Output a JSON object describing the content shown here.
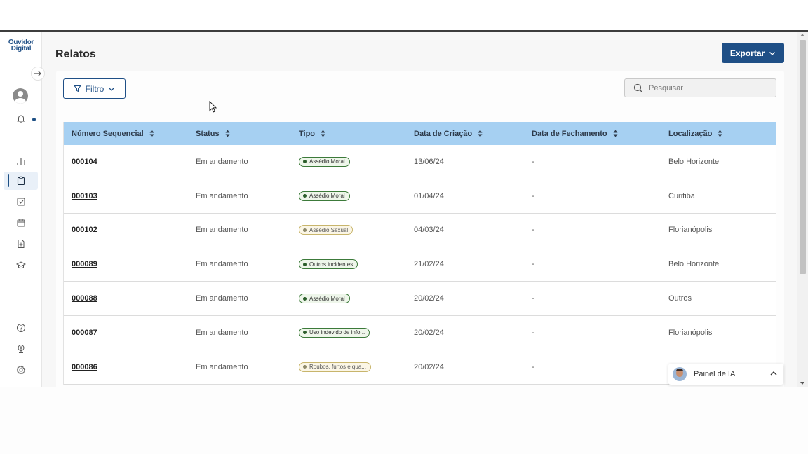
{
  "app": {
    "logo_line1": "Ouvidor",
    "logo_line2": "Digital",
    "page_title": "Relatos",
    "colors": {
      "brand": "#1f4f86",
      "table_header": "#a6d0f2",
      "tag_green": "#3c7a3a",
      "tag_yellow": "#c8b56c"
    }
  },
  "sidebar": {
    "items": [
      {
        "icon": "chart-icon"
      },
      {
        "icon": "clipboard-icon",
        "active": true
      },
      {
        "icon": "checkbox-icon"
      },
      {
        "icon": "calendar-icon"
      },
      {
        "icon": "file-add-icon"
      },
      {
        "icon": "graduation-cap-icon"
      }
    ],
    "bottom_items": [
      {
        "icon": "help-icon"
      },
      {
        "icon": "webcam-icon"
      },
      {
        "icon": "gear-icon"
      }
    ]
  },
  "toolbar": {
    "export_label": "Exportar",
    "filter_label": "Filtro",
    "search_placeholder": "Pesquisar"
  },
  "table": {
    "headers": [
      "Número Sequencial",
      "Status",
      "Tipo",
      "Data de Criação",
      "Data de Fechamento",
      "Localização"
    ],
    "rows": [
      {
        "seq": "000104",
        "status": "Em andamento",
        "tipo": "Assédio Moral",
        "tipo_color": "green",
        "criacao": "13/06/24",
        "fechamento": "-",
        "local": "Belo Horizonte"
      },
      {
        "seq": "000103",
        "status": "Em andamento",
        "tipo": "Assédio Moral",
        "tipo_color": "green",
        "criacao": "01/04/24",
        "fechamento": "-",
        "local": "Curitiba"
      },
      {
        "seq": "000102",
        "status": "Em andamento",
        "tipo": "Assédio Sexual",
        "tipo_color": "yellow",
        "criacao": "04/03/24",
        "fechamento": "-",
        "local": "Florianópolis"
      },
      {
        "seq": "000089",
        "status": "Em andamento",
        "tipo": "Outros incidentes",
        "tipo_color": "green",
        "criacao": "21/02/24",
        "fechamento": "-",
        "local": "Belo Horizonte"
      },
      {
        "seq": "000088",
        "status": "Em andamento",
        "tipo": "Assédio Moral",
        "tipo_color": "green",
        "criacao": "20/02/24",
        "fechamento": "-",
        "local": "Outros"
      },
      {
        "seq": "000087",
        "status": "Em andamento",
        "tipo": "Uso indevido de info...",
        "tipo_color": "green",
        "criacao": "20/02/24",
        "fechamento": "-",
        "local": "Florianópolis"
      },
      {
        "seq": "000086",
        "status": "Em andamento",
        "tipo": "Roubos, furtos e qua...",
        "tipo_color": "yellow",
        "criacao": "20/02/24",
        "fechamento": "-",
        "local": ""
      }
    ]
  },
  "ai_panel": {
    "label": "Painel de IA"
  }
}
